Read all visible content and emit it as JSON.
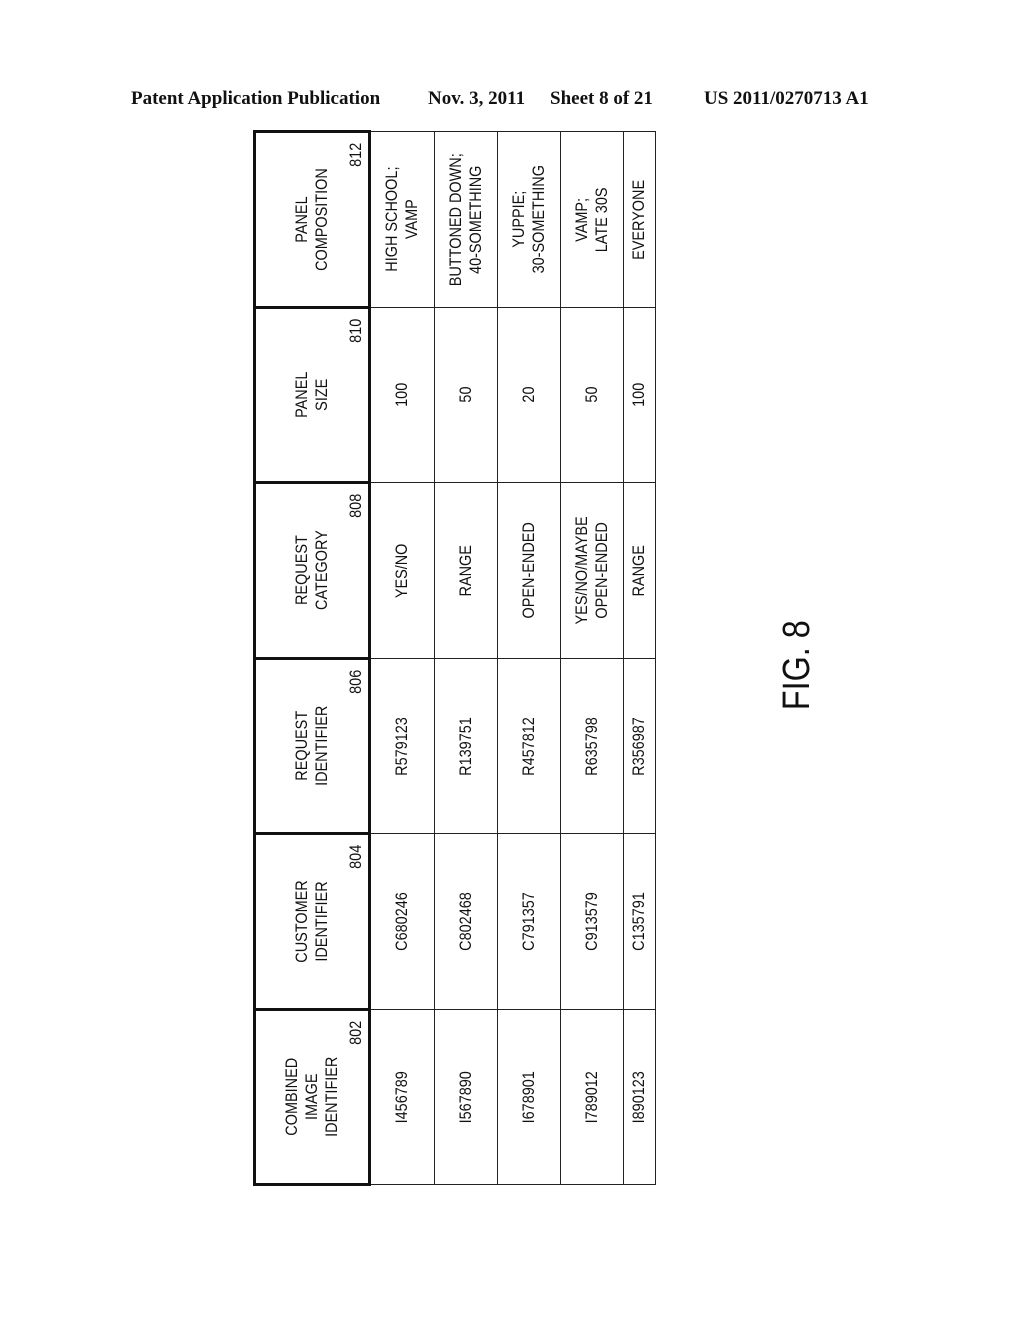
{
  "header": {
    "publication": "Patent Application Publication",
    "date": "Nov. 3, 2011",
    "sheet": "Sheet 8 of 21",
    "number": "US 2011/0270713 A1"
  },
  "table": {
    "columns": [
      {
        "label_lines": [
          "COMBINED",
          "IMAGE",
          "IDENTIFIER"
        ],
        "ref": "802"
      },
      {
        "label_lines": [
          "CUSTOMER",
          "IDENTIFIER"
        ],
        "ref": "804"
      },
      {
        "label_lines": [
          "REQUEST",
          "IDENTIFIER"
        ],
        "ref": "806"
      },
      {
        "label_lines": [
          "REQUEST",
          "CATEGORY"
        ],
        "ref": "808"
      },
      {
        "label_lines": [
          "PANEL",
          "SIZE"
        ],
        "ref": "810"
      },
      {
        "label_lines": [
          "PANEL",
          "COMPOSITION"
        ],
        "ref": "812"
      }
    ],
    "rows": [
      [
        [
          "I456789"
        ],
        [
          "C680246"
        ],
        [
          "R579123"
        ],
        [
          "YES/NO"
        ],
        [
          "100"
        ],
        [
          "HIGH SCHOOL;",
          "VAMP"
        ]
      ],
      [
        [
          "I567890"
        ],
        [
          "C802468"
        ],
        [
          "R139751"
        ],
        [
          "RANGE"
        ],
        [
          "50"
        ],
        [
          "BUTTONED DOWN;",
          "40-SOMETHING"
        ]
      ],
      [
        [
          "I678901"
        ],
        [
          "C791357"
        ],
        [
          "R457812"
        ],
        [
          "OPEN-ENDED"
        ],
        [
          "20"
        ],
        [
          "YUPPIE;",
          "30-SOMETHING"
        ]
      ],
      [
        [
          "I789012"
        ],
        [
          "C913579"
        ],
        [
          "R635798"
        ],
        [
          "YES/NO/MAYBE",
          "OPEN-ENDED"
        ],
        [
          "50"
        ],
        [
          "VAMP;",
          "LATE 30S"
        ]
      ],
      [
        [
          "I890123"
        ],
        [
          "C135791"
        ],
        [
          "R356987"
        ],
        [
          "RANGE"
        ],
        [
          "100"
        ],
        [
          "EVERYONE"
        ]
      ]
    ]
  },
  "figure_label": "FIG. 8"
}
